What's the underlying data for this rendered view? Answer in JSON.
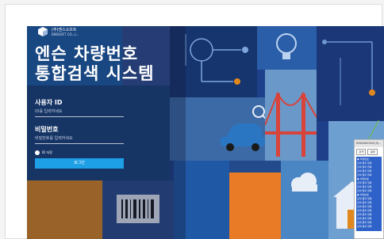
{
  "logo": {
    "line1": "(주)엔스소프트",
    "line2": "ENSSOFT CO., L.."
  },
  "title": {
    "line1": "엔슨 차량번호",
    "line2": "통합검색 시스템"
  },
  "form": {
    "user_id_label": "사용자 ID",
    "user_id_placeholder": "ID를 입력하세요",
    "password_label": "비밀번호",
    "password_placeholder": "비밀번호를 입력하세요",
    "remember_label": "ID 저장",
    "login_label": "로그인"
  },
  "popup": {
    "title": "ENSANSONIC(S)...",
    "tabs": [
      "검색",
      "설정"
    ],
    "rows": [
      "▣ 차량번호",
      "  검색 결과 항목",
      "  검색 결과 항목",
      "  검색 결과 항목",
      "  검색 결과 항목",
      "▣ 차량번호",
      "  검색 결과 항목",
      "  검색 결과 항목",
      "  검색 결과 항목",
      "▣ 차량번호",
      "  검색 결과 항목",
      "  검색 결과 항목",
      "  검색 결과 항목",
      "  검색 결과 항목",
      "  검색 결과 항목",
      "  검색 결과 항목",
      "  검색 결과 항목",
      "  검색 결과 항목"
    ]
  },
  "colors": {
    "login_button": "#1ea0e6",
    "background": "#1e3f8a",
    "accent_orange": "#e97a26"
  }
}
